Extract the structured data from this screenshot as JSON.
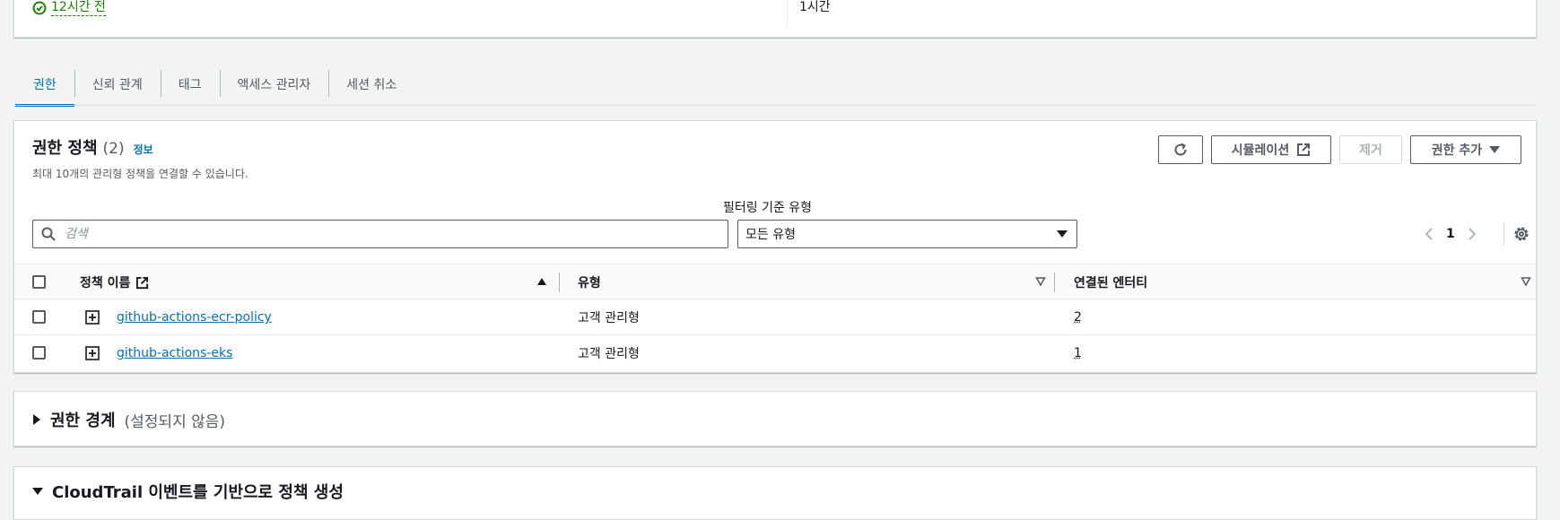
{
  "summary": {
    "last_used": "12시간 전",
    "max_session": "1시간"
  },
  "tabs": [
    {
      "label": "권한",
      "active": true
    },
    {
      "label": "신뢰 관계",
      "active": false
    },
    {
      "label": "태그",
      "active": false
    },
    {
      "label": "액세스 관리자",
      "active": false
    },
    {
      "label": "세션 취소",
      "active": false
    }
  ],
  "permissions": {
    "title": "권한 정책",
    "count": "(2)",
    "info_link": "정보",
    "description": "최대 10개의 관리형 정책을 연결할 수 있습니다.",
    "buttons": {
      "simulation": "시뮬레이션",
      "remove": "제거",
      "add": "권한 추가"
    },
    "filter_label": "필터링 기준 유형",
    "search_placeholder": "검색",
    "filter_value": "모든 유형",
    "page": "1",
    "columns": {
      "name": "정책 이름",
      "type": "유형",
      "entities": "연결된 엔터티"
    },
    "rows": [
      {
        "name": "github-actions-ecr-policy",
        "type": "고객 관리형",
        "entities": "2"
      },
      {
        "name": "github-actions-eks",
        "type": "고객 관리형",
        "entities": "1"
      }
    ]
  },
  "boundary": {
    "title": "권한 경계",
    "status": "(설정되지 않음)"
  },
  "cloudtrail": {
    "title": "CloudTrail 이벤트를 기반으로 정책 생성"
  },
  "colors": {
    "accent": "#0073bb",
    "success": "#1d8102",
    "border": "#d5dbdb"
  }
}
